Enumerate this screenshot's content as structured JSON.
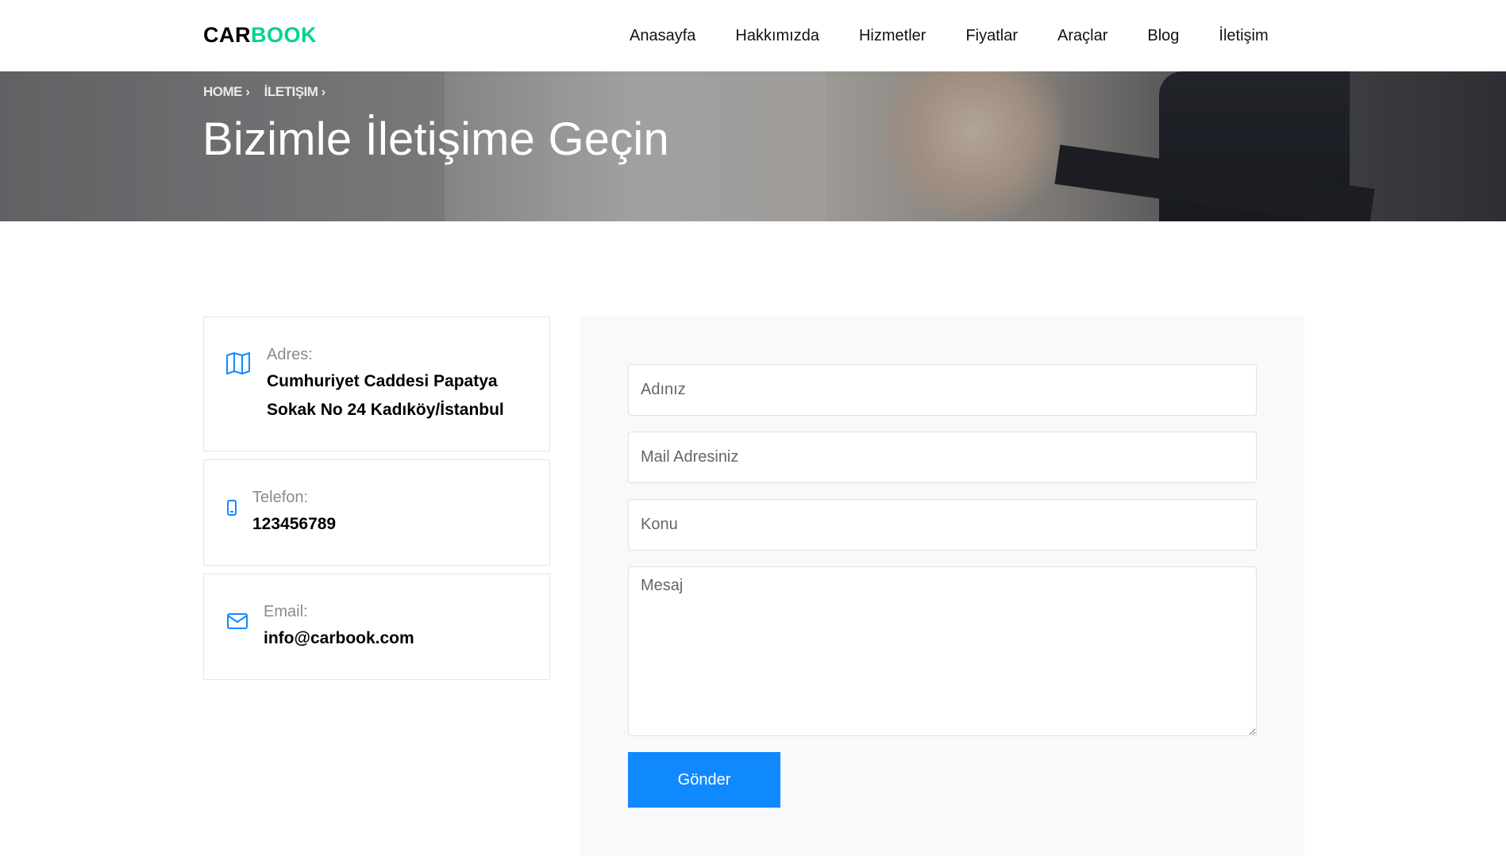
{
  "brand": {
    "part1": "CAR",
    "part2": "BOOK",
    "accent": "#01d28e"
  },
  "nav": {
    "items": [
      "Anasayfa",
      "Hakkımızda",
      "Hizmetler",
      "Fiyatlar",
      "Araçlar",
      "Blog",
      "İletişim"
    ]
  },
  "breadcrumb": {
    "home": "HOME",
    "home_sep": "›",
    "current": "İLETIŞIM",
    "current_sep": "›"
  },
  "hero": {
    "title": "Bizimle İletişime Geçin"
  },
  "contact": {
    "address": {
      "icon": "map-icon",
      "label": "Adres:",
      "line1": "Cumhuriyet Caddesi Papatya",
      "line2": "Sokak No 24 Kadıköy/İstanbul"
    },
    "phone": {
      "icon": "mobile-phone-icon",
      "label": "Telefon:",
      "value": "123456789"
    },
    "email": {
      "icon": "envelope-icon",
      "label": "Email:",
      "value": "info@carbook.com"
    }
  },
  "form": {
    "name_placeholder": "Adınız",
    "email_placeholder": "Mail Adresiniz",
    "subject_placeholder": "Konu",
    "message_placeholder": "Mesaj",
    "submit_label": "Gönder"
  },
  "colors": {
    "primary": "#1089ff",
    "form_bg": "#f8f9fa"
  }
}
